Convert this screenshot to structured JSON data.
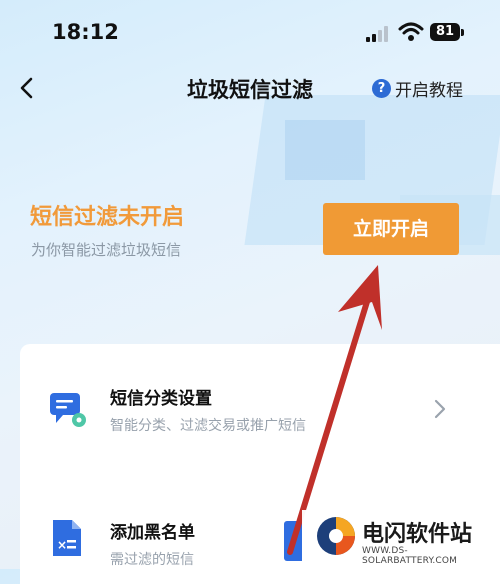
{
  "status_bar": {
    "time": "18:12",
    "battery": "81"
  },
  "nav": {
    "title": "垃圾短信过滤",
    "help_label": "开启教程"
  },
  "hero": {
    "title": "短信过滤未开启",
    "subtitle": "为你智能过滤垃圾短信",
    "button_label": "立即开启"
  },
  "settings": [
    {
      "title": "短信分类设置",
      "desc": "智能分类、过滤交易或推广短信"
    },
    {
      "title": "添加黑名单",
      "desc": "需过滤的短信"
    }
  ],
  "watermark": {
    "name": "电闪软件站",
    "url": "WWW.DS-SOLARBATTERY.COM"
  },
  "colors": {
    "accent": "#f09a35",
    "link": "#2d6bd4",
    "annotation": "#c0302a"
  }
}
